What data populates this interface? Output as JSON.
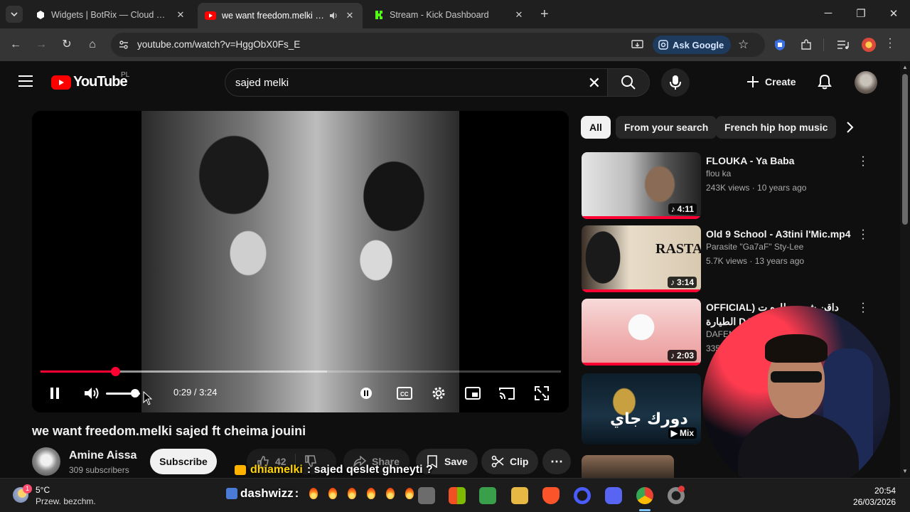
{
  "browser": {
    "tabs": [
      {
        "title": "Widgets | BotRix — Cloud Strea",
        "favicon_color": "#ffffff"
      },
      {
        "title": "we want freedom.melki saje",
        "favicon_color": "#ff0000"
      },
      {
        "title": "Stream - Kick Dashboard",
        "favicon_color": "#53fc18"
      }
    ],
    "url": "youtube.com/watch?v=HggObX0Fs_E",
    "ask_google": "Ask Google"
  },
  "youtube": {
    "logo_text": "YouTube",
    "country_code": "PL",
    "search_query": "sajed melki",
    "create_label": "Create"
  },
  "player": {
    "current_time": "0:29",
    "duration": "3:24",
    "played_fraction": 0.143,
    "loaded_fraction": 0.55,
    "volume_fraction": 0.85,
    "time_text": "0:29 / 3:24"
  },
  "video": {
    "title": "we want freedom.melki sajed ft cheima jouini",
    "channel": "Amine Aissa",
    "subscribers": "309 subscribers",
    "subscribe_label": "Subscribe",
    "likes": "42",
    "share_label": "Share",
    "save_label": "Save",
    "clip_label": "Clip"
  },
  "chat_overlay": {
    "user": "dhiamelki",
    "message": ": sajed qeslet ghneyti ?"
  },
  "chips": [
    "All",
    "From your search",
    "French hip hop music"
  ],
  "recommendations": [
    {
      "title": "FLOUKA  - Ya Baba",
      "channel": "flou ka",
      "views": "243K views · 10 years ago",
      "duration": "4:11",
      "thumb_color": "#3a3a3a"
    },
    {
      "title": "Old 9 School - A3tini l'Mic.mp4",
      "channel": "Parasite \"Ga7aF\" Sty-Lee",
      "views": "5.7K views · 13 years ago",
      "duration": "3:14",
      "thumb_color": "#d8cbb8"
    },
    {
      "title": "OFFICIAL) داقن شي - طاره ت الطيارة DAFENCII",
      "channel": "DAFEN",
      "views": "335",
      "duration": "2:03",
      "thumb_color": "#f0b6b6"
    },
    {
      "title": "",
      "channel": "",
      "views": "",
      "duration": "Mix",
      "thumb_color": "#0d1e2a"
    }
  ],
  "taskbar": {
    "weather_badge": "1",
    "temperature": "5°C",
    "weather_desc": "Przew. bezchm.",
    "overlay_name": "dashwizz",
    "overlay_suffix": ":",
    "time": "20:54",
    "date": "26/03/2026"
  },
  "colors": {
    "accent_red": "#ff0033",
    "kick_green": "#53fc18"
  }
}
